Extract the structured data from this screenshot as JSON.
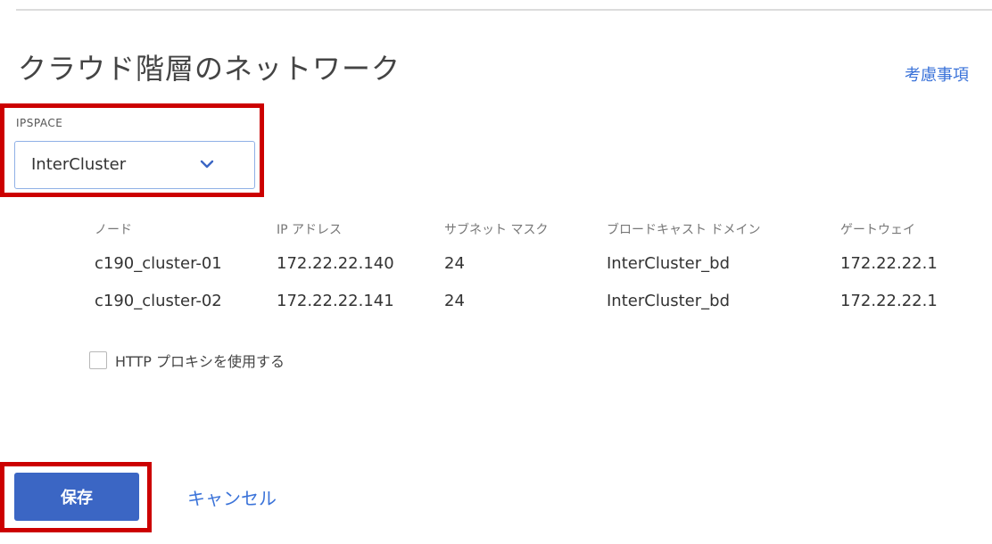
{
  "header": {
    "title": "クラウド階層のネットワーク",
    "considerations_link": "考慮事項"
  },
  "ipspace": {
    "label": "IPSPACE",
    "selected": "InterCluster",
    "icon": "chevron-down-icon"
  },
  "table": {
    "headers": {
      "node": "ノード",
      "ip": "IP アドレス",
      "mask": "サブネット マスク",
      "broadcast_domain": "ブロードキャスト ドメイン",
      "gateway": "ゲートウェイ"
    },
    "rows": [
      {
        "node": "c190_cluster-01",
        "ip": "172.22.22.140",
        "mask": "24",
        "broadcast_domain": "InterCluster_bd",
        "gateway": "172.22.22.1"
      },
      {
        "node": "c190_cluster-02",
        "ip": "172.22.22.141",
        "mask": "24",
        "broadcast_domain": "InterCluster_bd",
        "gateway": "172.22.22.1"
      }
    ]
  },
  "proxy": {
    "label": "HTTP プロキシを使用する",
    "checked": false
  },
  "actions": {
    "save_label": "保存",
    "cancel_label": "キャンセル"
  },
  "colors": {
    "accent": "#3b66c4",
    "link": "#3b73d9",
    "highlight": "#cc0000",
    "select_border": "#8fb0e6"
  }
}
